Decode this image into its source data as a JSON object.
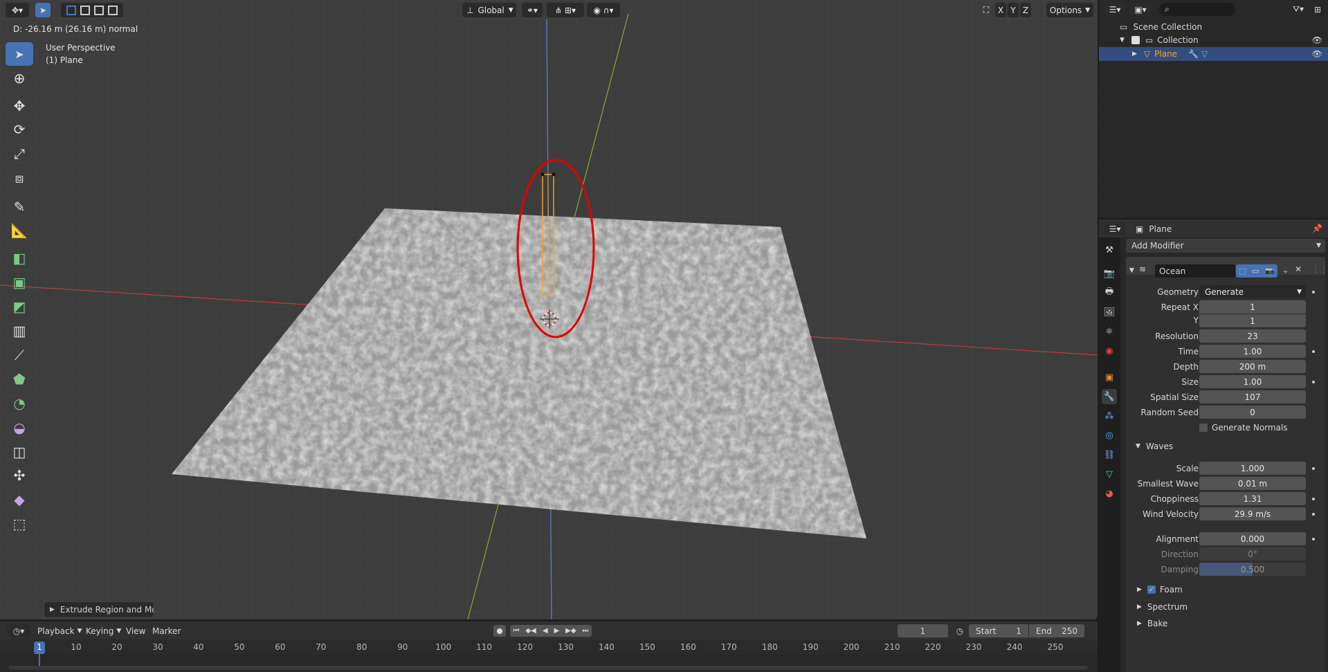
{
  "viewport": {
    "orientation": "Global",
    "options_label": "Options",
    "axis_x": "X",
    "axis_y": "Y",
    "axis_z": "Z",
    "status_text": "D: -26.16 m (26.16 m) normal",
    "perspective_label": "User Perspective",
    "object_label": "(1) Plane",
    "redo_panel_label": "Extrude Region and Mov"
  },
  "outliner": {
    "scene_collection": "Scene Collection",
    "collection": "Collection",
    "object": "Plane"
  },
  "properties": {
    "object_name": "Plane",
    "add_modifier": "Add Modifier",
    "modifier_name": "Ocean",
    "fields": [
      {
        "label": "Geometry",
        "value": "Generate"
      },
      {
        "label": "Repeat X",
        "value": "1"
      },
      {
        "label": "Y",
        "value": "1"
      },
      {
        "label": "Resolution",
        "value": "23"
      },
      {
        "label": "Time",
        "value": "1.00"
      },
      {
        "label": "Depth",
        "value": "200 m"
      },
      {
        "label": "Size",
        "value": "1.00"
      },
      {
        "label": "Spatial Size",
        "value": "107"
      },
      {
        "label": "Random Seed",
        "value": "0"
      }
    ],
    "generate_normals": "Generate Normals",
    "waves_panel": "Waves",
    "wave_fields": [
      {
        "label": "Scale",
        "value": "1.000"
      },
      {
        "label": "Smallest Wave",
        "value": "0.01 m"
      },
      {
        "label": "Choppiness",
        "value": "1.31"
      },
      {
        "label": "Wind Velocity",
        "value": "29.9 m/s"
      },
      {
        "label": "Alignment",
        "value": "0.000"
      },
      {
        "label": "Direction",
        "value": "0°"
      },
      {
        "label": "Damping",
        "value": "0.500"
      }
    ],
    "damping_fraction": 0.5,
    "foam_panel": "Foam",
    "spectrum_panel": "Spectrum",
    "bake_panel": "Bake"
  },
  "timeline": {
    "playback": "Playback",
    "keying": "Keying",
    "view": "View",
    "marker": "Marker",
    "current_frame": "1",
    "start_label": "Start",
    "start_value": "1",
    "end_label": "End",
    "end_value": "250",
    "ticks": [
      "1",
      "10",
      "20",
      "30",
      "40",
      "50",
      "60",
      "70",
      "80",
      "90",
      "100",
      "110",
      "120",
      "130",
      "140",
      "150",
      "160",
      "170",
      "180",
      "190",
      "200",
      "210",
      "220",
      "230",
      "240",
      "250"
    ]
  },
  "colors": {
    "accent": "#4772b3",
    "selected_object": "#f5a623",
    "annotation": "#e00000",
    "x_axis": "#b33c3c",
    "y_axis": "#7fa33a",
    "z_axis": "#5a7fc4"
  }
}
